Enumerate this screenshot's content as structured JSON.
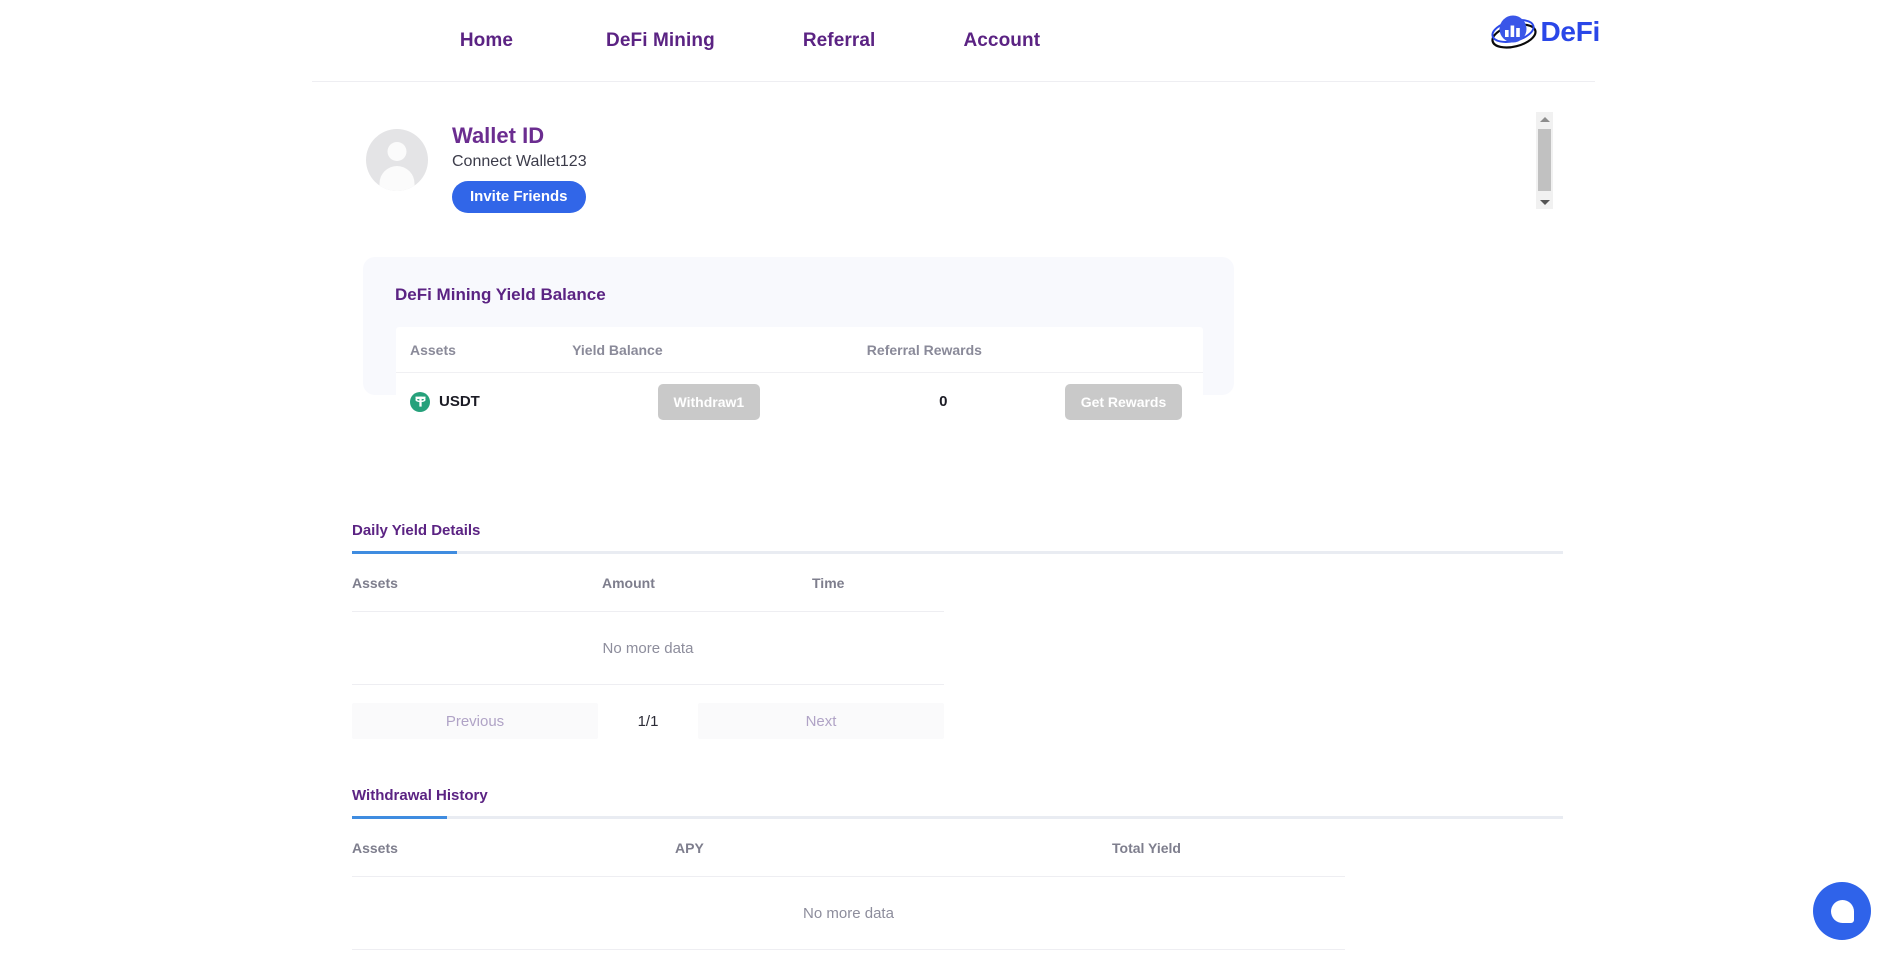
{
  "nav": {
    "links": [
      {
        "label": "Home",
        "name": "nav-home"
      },
      {
        "label": "DeFi Mining",
        "name": "nav-defi-mining"
      },
      {
        "label": "Referral",
        "name": "nav-referral"
      },
      {
        "label": "Account",
        "name": "nav-account"
      }
    ],
    "brand_text": "DeFi",
    "brand_icon": "defi-chart-globe-logo",
    "brand_color": "#2a47e8"
  },
  "profile": {
    "avatar_icon": "user-avatar-placeholder",
    "wallet_title": "Wallet ID",
    "wallet_subtitle": "Connect Wallet123",
    "invite_button": "Invite Friends",
    "invite_color": "#3166e8"
  },
  "yield_card": {
    "title": "DeFi Mining Yield Balance",
    "columns": [
      "Assets",
      "Yield Balance",
      "Referral Rewards",
      ""
    ],
    "row": {
      "asset_icon": "usdt-tether-icon",
      "asset_icon_color": "#26a17b",
      "asset": "USDT",
      "yield_balance": "",
      "withdraw_button": "Withdraw1",
      "referral_rewards": "0",
      "get_rewards_button": "Get Rewards",
      "button_color": "#c9c9c9"
    }
  },
  "daily_yield": {
    "tab_label": "Daily Yield Details",
    "columns": [
      "Assets",
      "Amount",
      "Time"
    ],
    "empty_text": "No more data",
    "pagination": {
      "previous": "Previous",
      "indicator": "1/1",
      "next": "Next"
    }
  },
  "withdrawal_history": {
    "tab_label": "Withdrawal History",
    "columns": [
      "Assets",
      "APY",
      "Total Yield"
    ],
    "empty_text": "No more data"
  },
  "chat": {
    "icon": "chat-bubble-icon",
    "color": "#2f63ea"
  }
}
